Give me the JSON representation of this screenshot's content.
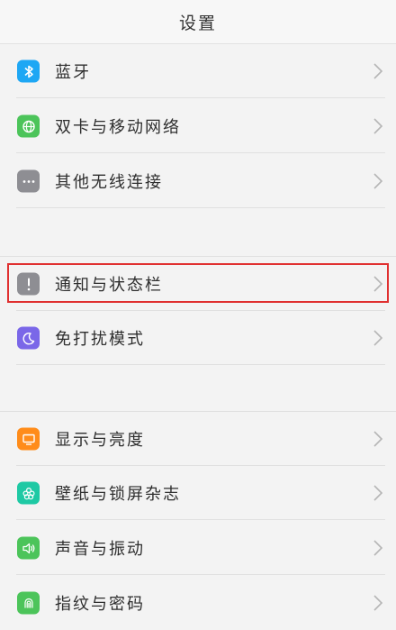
{
  "header": {
    "title": "设置"
  },
  "items": [
    {
      "label": "蓝牙",
      "icon": "bluetooth-icon",
      "color": "#1ea7f4"
    },
    {
      "label": "双卡与移动网络",
      "icon": "globe-icon",
      "color": "#4cc45a"
    },
    {
      "label": "其他无线连接",
      "icon": "more-dots-icon",
      "color": "#8e8e93"
    },
    {
      "label": "通知与状态栏",
      "icon": "exclamation-icon",
      "color": "#8e8e93"
    },
    {
      "label": "免打扰模式",
      "icon": "moon-icon",
      "color": "#7a67e8"
    },
    {
      "label": "显示与亮度",
      "icon": "monitor-icon",
      "color": "#ff8c1a"
    },
    {
      "label": "壁纸与锁屏杂志",
      "icon": "flower-icon",
      "color": "#1ec9a4"
    },
    {
      "label": "声音与振动",
      "icon": "speaker-icon",
      "color": "#4cc45a"
    },
    {
      "label": "指纹与密码",
      "icon": "fingerprint-icon",
      "color": "#4cc45a"
    }
  ]
}
